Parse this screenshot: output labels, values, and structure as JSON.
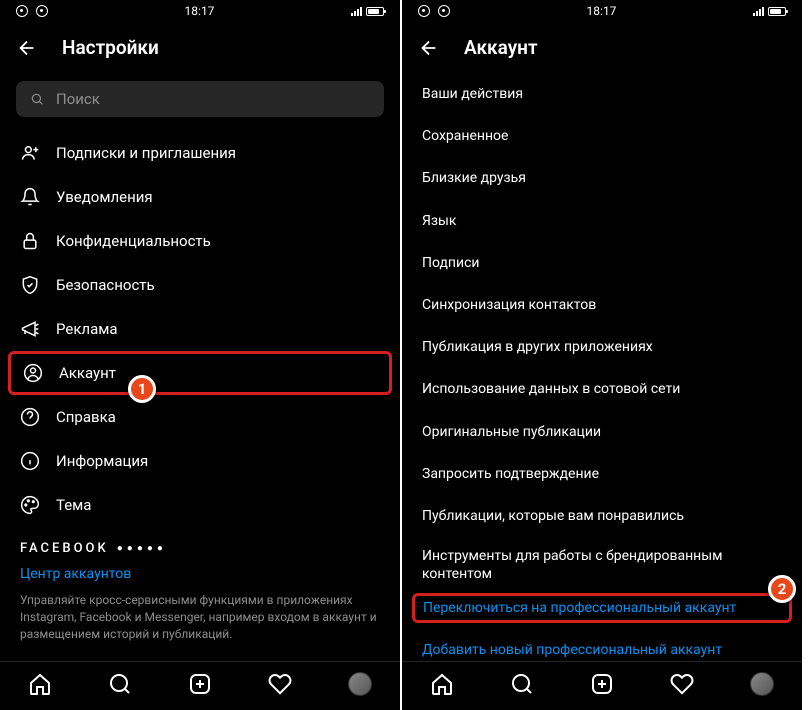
{
  "left": {
    "status_time": "18:17",
    "header_title": "Настройки",
    "search_placeholder": "Поиск",
    "items": [
      {
        "label": "Подписки и приглашения"
      },
      {
        "label": "Уведомления"
      },
      {
        "label": "Конфиденциальность"
      },
      {
        "label": "Безопасность"
      },
      {
        "label": "Реклама"
      },
      {
        "label": "Аккаунт"
      },
      {
        "label": "Справка"
      },
      {
        "label": "Информация"
      },
      {
        "label": "Тема"
      }
    ],
    "facebook_brand": "FACEBOOK",
    "accounts_center": "Центр аккаунтов",
    "footer_desc": "Управляйте кросс-сервисными функциями в приложениях Instagram, Facebook и Messenger, например входом в аккаунт и размещением историй и публикаций.",
    "marker": "1"
  },
  "right": {
    "status_time": "18:17",
    "header_title": "Аккаунт",
    "items": [
      {
        "label": "Ваши действия"
      },
      {
        "label": "Сохраненное"
      },
      {
        "label": "Близкие друзья"
      },
      {
        "label": "Язык"
      },
      {
        "label": "Подписи"
      },
      {
        "label": "Синхронизация контактов"
      },
      {
        "label": "Публикация в других приложениях"
      },
      {
        "label": "Использование данных в сотовой сети"
      },
      {
        "label": "Оригинальные публикации"
      },
      {
        "label": "Запросить подтверждение"
      },
      {
        "label": "Публикации, которые вам понравились"
      },
      {
        "label": "Инструменты для работы с брендированным контентом"
      }
    ],
    "switch_pro": "Переключиться на профессиональный аккаунт",
    "add_pro": "Добавить новый профессиональный аккаунт",
    "marker": "2"
  }
}
